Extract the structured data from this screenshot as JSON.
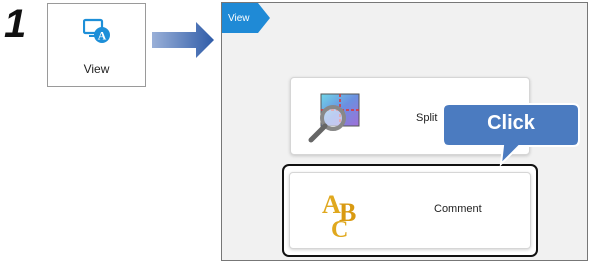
{
  "step": {
    "number": "1"
  },
  "view_tile": {
    "label": "View",
    "icon": "monitor-a-icon"
  },
  "flow_arrow": {
    "icon": "right-arrow-icon",
    "color": "#3a64b0"
  },
  "panel": {
    "tab_label": "View",
    "tab_color": "#1f8ad6",
    "options": [
      {
        "label": "Split",
        "icon": "split-magnifier-icon"
      },
      {
        "label": "Comment",
        "icon": "abc-icon"
      }
    ]
  },
  "callout": {
    "label": "Click",
    "color": "#4b7bc0"
  }
}
